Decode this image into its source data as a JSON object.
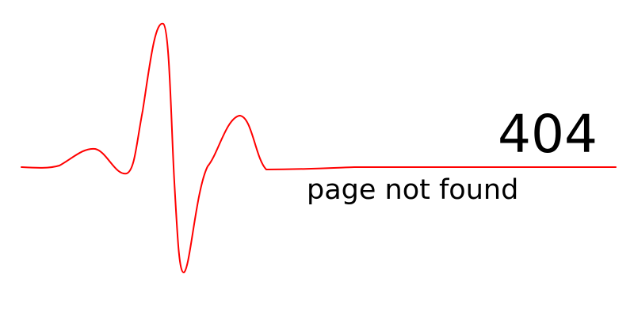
{
  "error": {
    "code": "404",
    "message": "page not found"
  },
  "graphic": {
    "icon": "heartbeat-line-icon",
    "stroke_color": "#ff0000",
    "text_color": "#000000",
    "background_color": "#ffffff"
  }
}
